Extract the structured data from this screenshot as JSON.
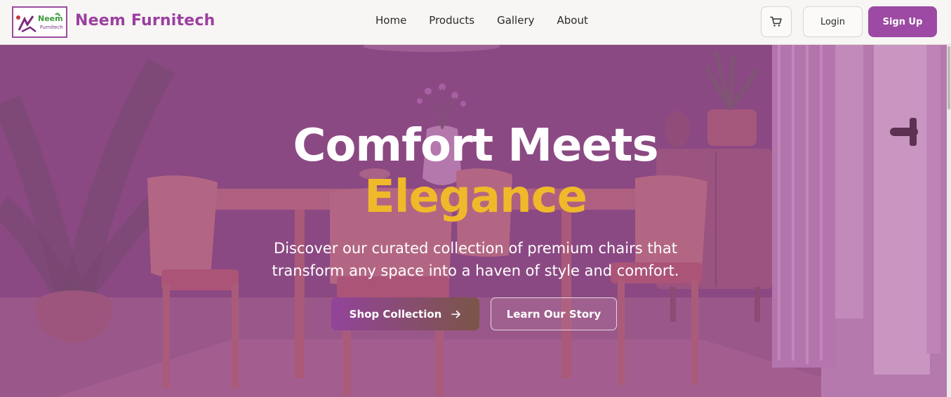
{
  "brand": {
    "logo_top": "Neem",
    "logo_bottom": "Furnitech",
    "name": "Neem Furnitech",
    "color": "#9b3fa0"
  },
  "nav": {
    "links": [
      {
        "label": "Home"
      },
      {
        "label": "Products"
      },
      {
        "label": "Gallery"
      },
      {
        "label": "About"
      }
    ]
  },
  "actions": {
    "cart_icon": "shopping-cart-icon",
    "login_label": "Login",
    "signup_label": "Sign Up",
    "signup_color": "#9c4aa3"
  },
  "hero": {
    "title_line1": "Comfort Meets",
    "title_line2": "Elegance",
    "title_accent_color": "#f0b92a",
    "subtitle": "Discover our curated collection of premium chairs that transform any space into a haven of style and comfort.",
    "primary_cta": "Shop Collection",
    "primary_cta_icon": "arrow-right-icon",
    "secondary_cta": "Learn Our Story"
  }
}
